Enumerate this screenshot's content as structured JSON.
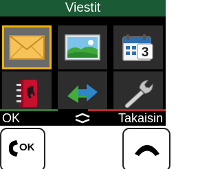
{
  "screen": {
    "title": "Viestit",
    "menu_items": [
      {
        "icon": "envelope-icon",
        "selected": true
      },
      {
        "icon": "picture-icon",
        "selected": false
      },
      {
        "icon": "calendar-icon",
        "selected": false
      },
      {
        "icon": "phonebook-icon",
        "selected": false
      },
      {
        "icon": "transfer-arrows-icon",
        "selected": false
      },
      {
        "icon": "wrench-icon",
        "selected": false
      }
    ]
  },
  "softkeys": {
    "left_label": "OK",
    "right_label": "Takaisin",
    "left_color": "#3d7a3d",
    "right_color": "#c0282d"
  },
  "hardware_keys": {
    "left_label": "OK"
  },
  "colors": {
    "title_bg": "#1a5a34",
    "selection_border": "#f0b400"
  }
}
